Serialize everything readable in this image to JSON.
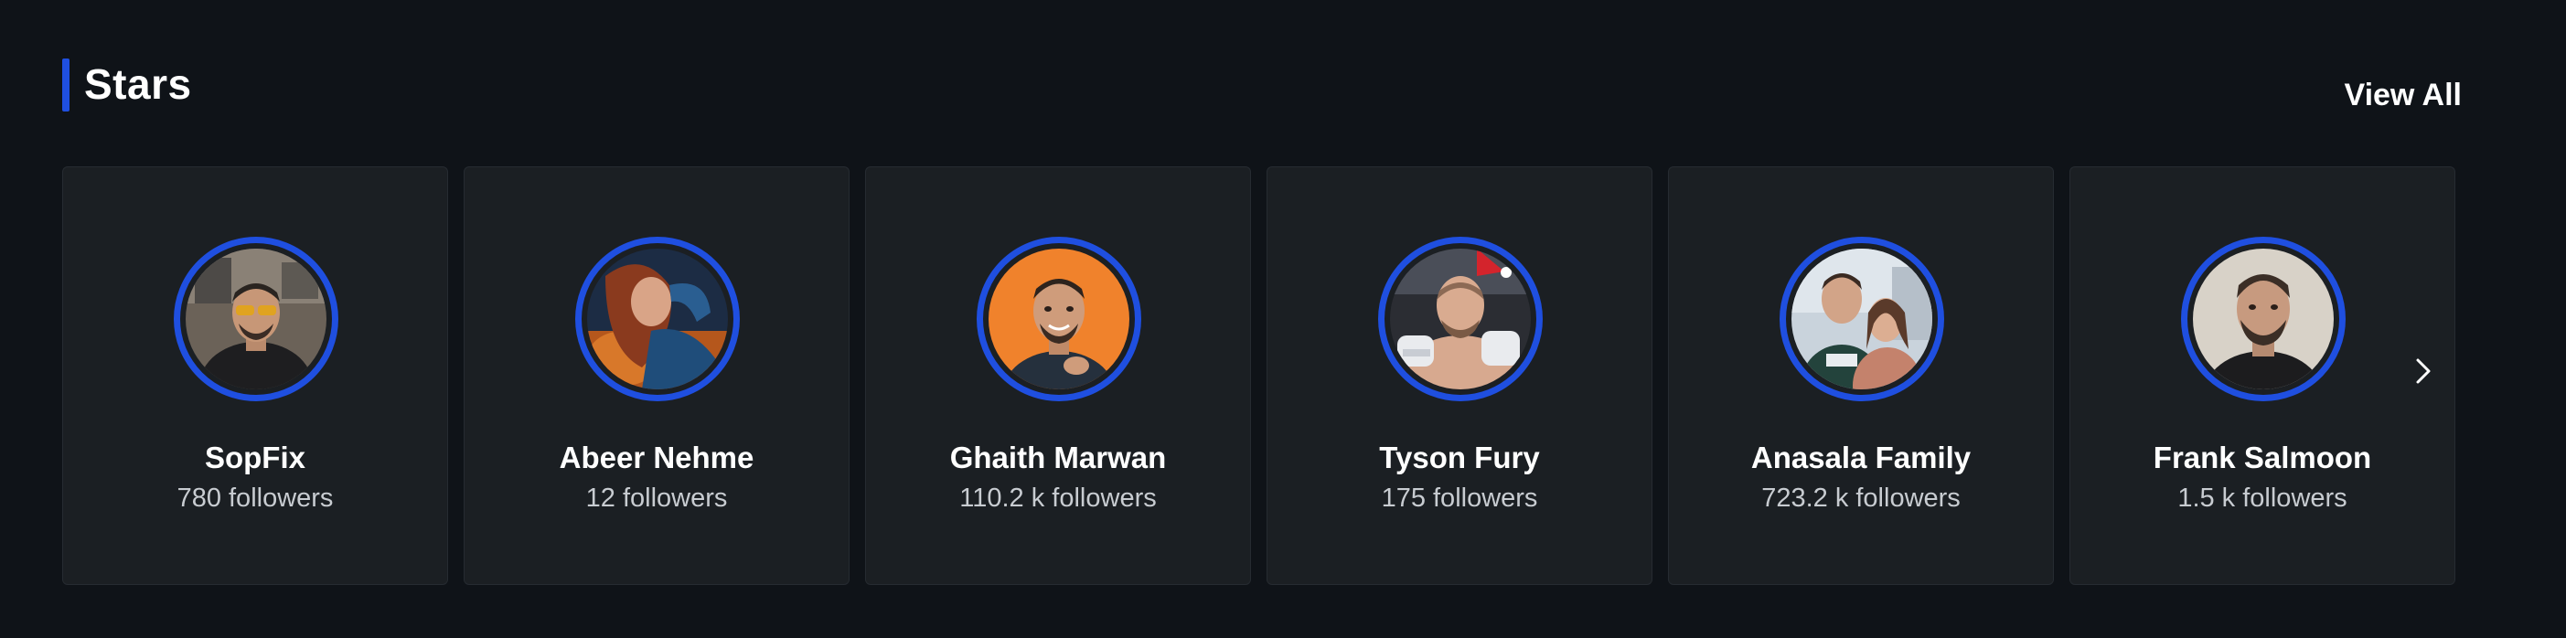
{
  "section": {
    "title": "Stars",
    "view_all_label": "View All"
  },
  "colors": {
    "background": "#0f1318",
    "card_background": "#1b1f23",
    "accent": "#1f4fe0",
    "text_primary": "#ffffff",
    "text_secondary": "#c8ccd1"
  },
  "stars": [
    {
      "name": "SopFix",
      "followers": "780 followers",
      "avatar_icon": "avatar-sopfix"
    },
    {
      "name": "Abeer Nehme",
      "followers": "12 followers",
      "avatar_icon": "avatar-abeer-nehme"
    },
    {
      "name": "Ghaith Marwan",
      "followers": "110.2 k followers",
      "avatar_icon": "avatar-ghaith-marwan"
    },
    {
      "name": "Tyson Fury",
      "followers": "175 followers",
      "avatar_icon": "avatar-tyson-fury"
    },
    {
      "name": "Anasala Family",
      "followers": "723.2 k followers",
      "avatar_icon": "avatar-anasala-family"
    },
    {
      "name": "Frank Salmoon",
      "followers": "1.5 k followers",
      "avatar_icon": "avatar-frank-salmoon"
    }
  ],
  "carousel": {
    "next_icon": "chevron-right-icon"
  }
}
